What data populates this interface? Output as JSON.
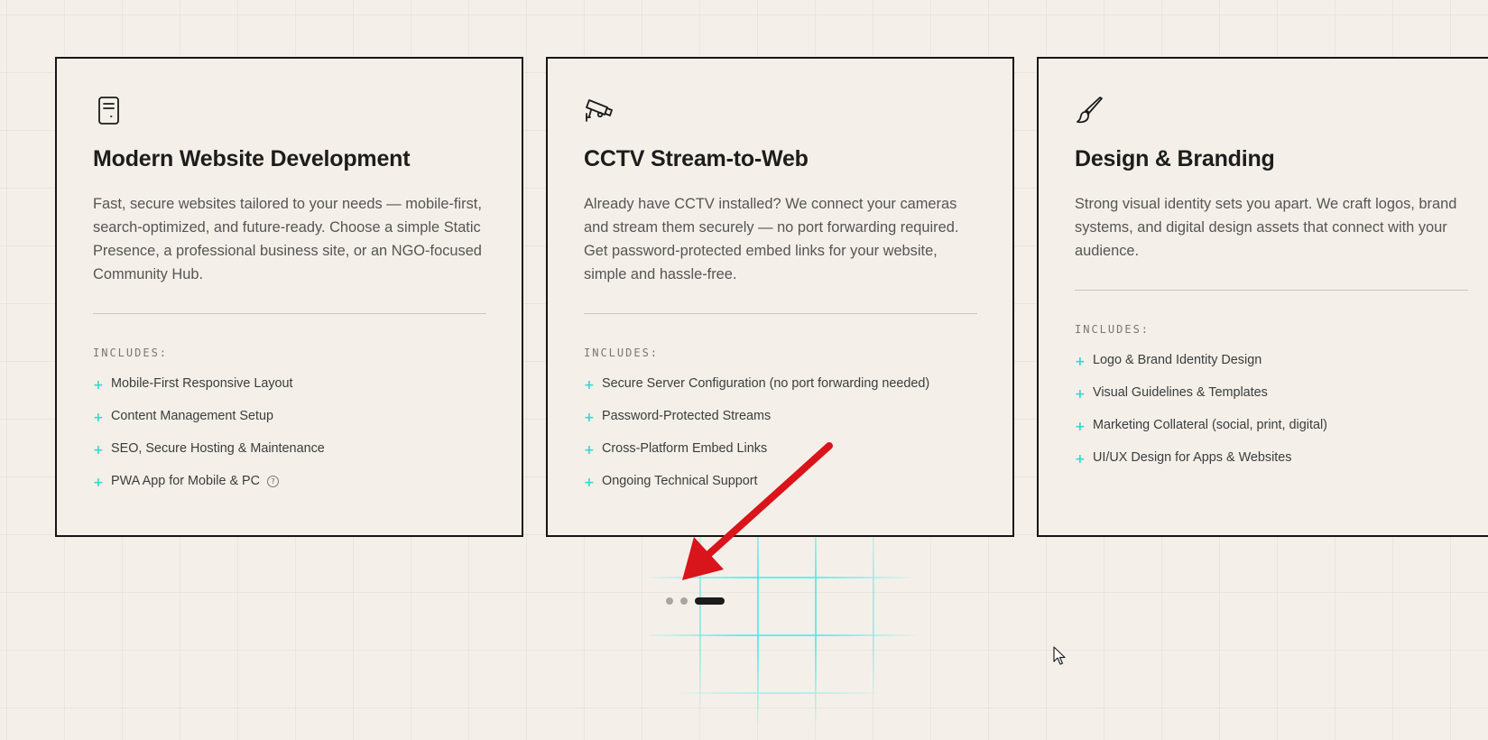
{
  "cards": [
    {
      "icon": "document-icon",
      "title": "Modern Website Development",
      "description": "Fast, secure websites tailored to your needs — mobile-first, search-optimized, and future-ready. Choose a simple Static Presence, a professional business site, or an NGO-focused Community Hub.",
      "includes_label": "INCLUDES:",
      "features": [
        "Mobile-First Responsive Layout",
        "Content Management Setup",
        "SEO, Secure Hosting & Maintenance",
        "PWA App for Mobile & PC"
      ],
      "help_glyph": "?"
    },
    {
      "icon": "cctv-camera-icon",
      "title": "CCTV Stream-to-Web",
      "description": "Already have CCTV installed? We connect your cameras and stream them securely — no port forwarding required. Get password-protected embed links for your website, simple and hassle-free.",
      "includes_label": "INCLUDES:",
      "features": [
        "Secure Server Configuration (no port forwarding needed)",
        "Password-Protected Streams",
        "Cross-Platform Embed Links",
        "Ongoing Technical Support"
      ]
    },
    {
      "icon": "paintbrush-icon",
      "title": "Design & Branding",
      "description": "Strong visual identity sets you apart. We craft logos, brand systems, and digital design assets that connect with your audience.",
      "includes_label": "INCLUDES:",
      "features": [
        "Logo & Brand Identity Design",
        "Visual Guidelines & Templates",
        "Marketing Collateral (social, print, digital)",
        "UI/UX Design for Apps & Websites"
      ]
    }
  ],
  "pagination": {
    "count": 3,
    "active_index": 2
  },
  "colors": {
    "background": "#f4f0e9",
    "accent": "#36d8d4",
    "border": "#161616",
    "annotation_arrow": "#d9141a"
  }
}
